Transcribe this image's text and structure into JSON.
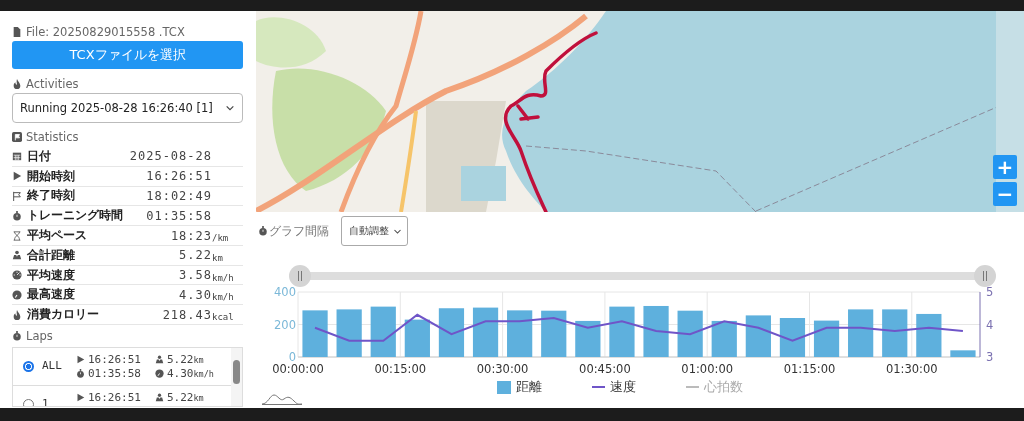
{
  "file_label": "File: 20250829015558 .TCX",
  "choose_button": "TCXファイルを選択",
  "activities": {
    "heading": "Activities",
    "value": "Running 2025-08-28 16:26:40 [1]"
  },
  "statistics": {
    "heading": "Statistics",
    "rows": [
      {
        "label": "日付",
        "value": "2025-08-28"
      },
      {
        "label": "開始時刻",
        "value": "16:26:51"
      },
      {
        "label": "終了時刻",
        "value": "18:02:49"
      },
      {
        "label": "トレーニング時間",
        "value": "01:35:58"
      },
      {
        "label": "平均ペース",
        "value": "18:23",
        "unit": "/km"
      },
      {
        "label": "合計距離",
        "value": "5.22",
        "unit": "km"
      },
      {
        "label": "平均速度",
        "value": "3.58",
        "unit": "km/h"
      },
      {
        "label": "最高速度",
        "value": "4.30",
        "unit": "km/h"
      },
      {
        "label": "消費カロリー",
        "value": "218.43",
        "unit": "kcal"
      }
    ]
  },
  "laps": {
    "heading": "Laps",
    "items": [
      {
        "label": "ALL",
        "selected": true,
        "start": "16:26:51",
        "distance": "5.22",
        "distance_unit": "km",
        "duration": "01:35:58",
        "max_speed": "4.30",
        "speed_unit": "km/h"
      },
      {
        "label": "1",
        "selected": false,
        "start": "16:26:51",
        "distance": "5.22",
        "distance_unit": "km"
      }
    ]
  },
  "map": {
    "zoom_buttons": [
      "+",
      "−"
    ]
  },
  "chart": {
    "interval_label": "グラフ間隔",
    "interval_value": "自動調整",
    "chart_data": {
      "type": "bar",
      "x": [
        2.5,
        7.5,
        12.5,
        17.5,
        22.5,
        27.5,
        32.5,
        37.5,
        42.5,
        47.5,
        52.5,
        57.5,
        62.5,
        67.5,
        72.5,
        77.5,
        82.5,
        87.5,
        92.5,
        97.5
      ],
      "series": [
        {
          "name": "距離",
          "color": "#5eb0dd",
          "values": [
            287,
            293,
            310,
            230,
            300,
            304,
            287,
            285,
            222,
            310,
            314,
            285,
            222,
            256,
            240,
            224,
            293,
            293,
            265,
            41
          ]
        },
        {
          "name": "速度",
          "type": "line",
          "axis": "y2",
          "color": "#6f55c8",
          "values": [
            3.9,
            3.5,
            3.5,
            4.3,
            3.7,
            4.1,
            4.1,
            4.2,
            3.9,
            4.1,
            3.8,
            3.7,
            4.1,
            3.9,
            3.5,
            3.9,
            3.9,
            3.8,
            3.9,
            3.8
          ]
        }
      ],
      "xlim": [
        0,
        100
      ],
      "ylim": [
        0,
        400
      ],
      "y2lim": [
        3,
        5
      ],
      "xticks": [
        {
          "value": 0,
          "label": "00:00:00"
        },
        {
          "value": 15,
          "label": "00:15:00"
        },
        {
          "value": 30,
          "label": "00:30:00"
        },
        {
          "value": 45,
          "label": "00:45:00"
        },
        {
          "value": 60,
          "label": "01:00:00"
        },
        {
          "value": 75,
          "label": "01:15:00"
        },
        {
          "value": 90,
          "label": "01:30:00"
        }
      ],
      "yticks": [
        0,
        200,
        400
      ],
      "y2ticks": [
        3,
        4,
        5
      ],
      "grid": true
    },
    "legend": [
      {
        "kind": "bar",
        "hidden": false
      },
      {
        "kind": "line",
        "hidden": false
      },
      {
        "label": "心拍数",
        "kind": "line",
        "hidden": true
      }
    ]
  }
}
